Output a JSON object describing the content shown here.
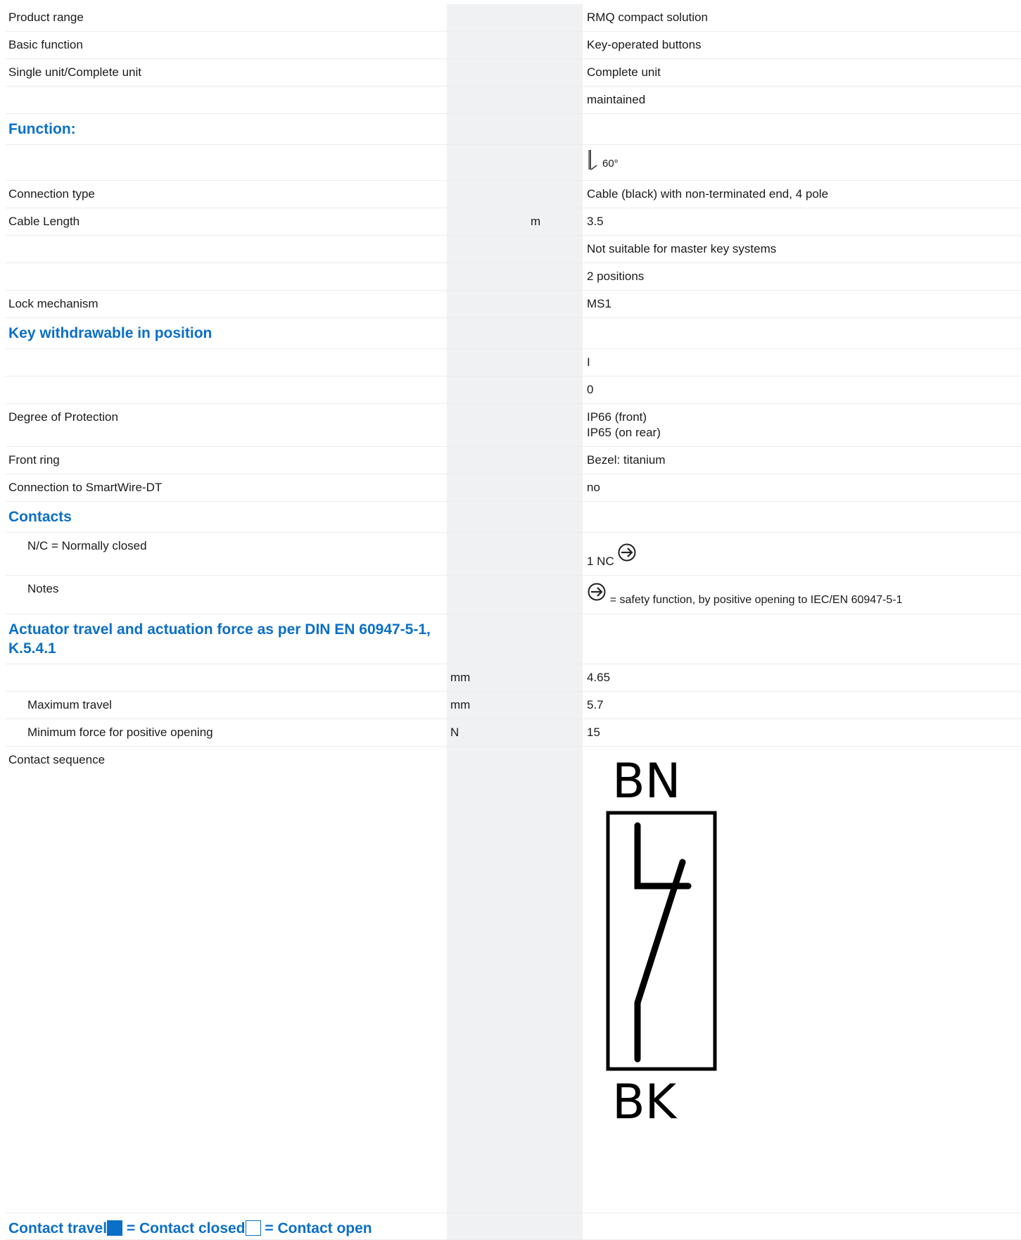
{
  "rows": {
    "product_range": {
      "label": "Product range",
      "value": "RMQ compact solution"
    },
    "basic_function": {
      "label": "Basic function",
      "value": "Key-operated buttons"
    },
    "single_complete": {
      "label": "Single unit/Complete unit",
      "value": "Complete unit"
    },
    "maintained": {
      "value": "maintained"
    },
    "function_heading": "Function:",
    "angle": {
      "value": "60°",
      "icon": "key-angle-icon"
    },
    "connection_type": {
      "label": "Connection type",
      "value": "Cable (black) with non-terminated end, 4 pole"
    },
    "cable_length": {
      "label": "Cable Length",
      "unit": "m",
      "value": "3.5"
    },
    "master_key": {
      "value": "Not suitable for master key systems"
    },
    "positions": {
      "value": "2 positions"
    },
    "lock_mechanism": {
      "label": "Lock mechanism",
      "value": "MS1"
    },
    "key_withdrawable_heading": "Key withdrawable in position",
    "pos_i": {
      "value": "I"
    },
    "pos_0": {
      "value": "0"
    },
    "degree_protection": {
      "label": "Degree of Protection",
      "value_line1": "IP66 (front)",
      "value_line2": "IP65 (on rear)"
    },
    "front_ring": {
      "label": "Front ring",
      "value": "Bezel: titanium"
    },
    "smartwire": {
      "label": "Connection to SmartWire-DT",
      "value": "no"
    },
    "contacts_heading": "Contacts",
    "nc": {
      "label": "N/C = Normally closed",
      "value": "1 NC",
      "icon": "positive-opening-icon"
    },
    "notes": {
      "label": "Notes",
      "value": "= safety function, by positive opening to IEC/EN 60947-5-1",
      "icon": "positive-opening-icon"
    },
    "actuator_heading_line1": "Actuator travel and actuation force as per DIN EN 60947-5-1,",
    "actuator_heading_line2": "K.5.4.1",
    "travel_first": {
      "unit": "mm",
      "value": "4.65"
    },
    "max_travel": {
      "label": "Maximum travel",
      "unit": "mm",
      "value": "5.7"
    },
    "min_force": {
      "label": "Minimum force for positive opening",
      "unit": "N",
      "value": "15"
    },
    "contact_sequence": {
      "label": "Contact sequence",
      "diagram_top": "BN",
      "diagram_bottom": "BK"
    },
    "legend": {
      "part1": "Contact travel",
      "part2": " = Contact closed",
      "part3": " = Contact open",
      "closed_color": "#0a6fc7"
    }
  }
}
